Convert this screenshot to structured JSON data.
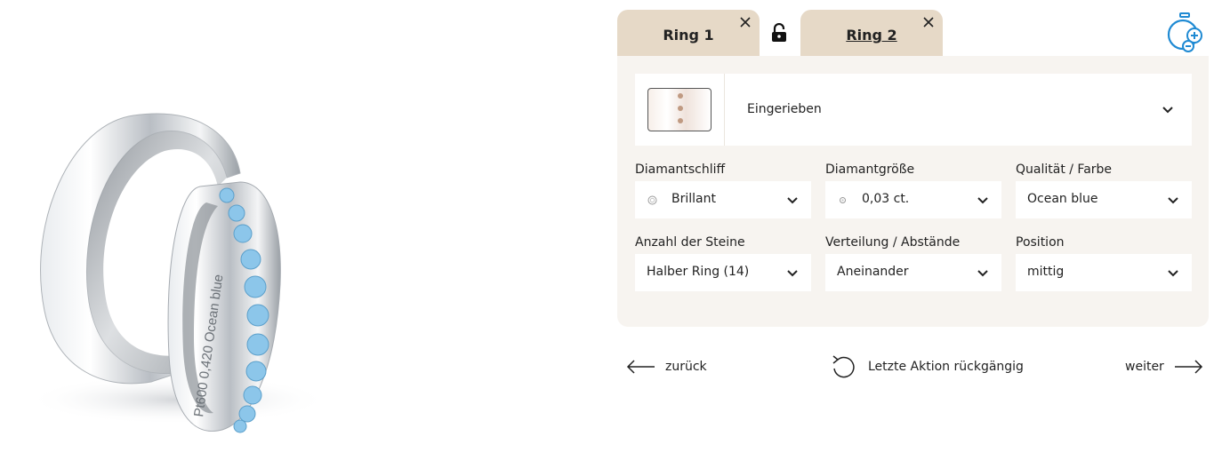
{
  "tabs": [
    {
      "label": "Ring 1"
    },
    {
      "label": "Ring 2"
    }
  ],
  "finish": {
    "selected": "Eingerieben"
  },
  "fields": {
    "diamond_cut": {
      "label": "Diamantschliff",
      "value": "Brillant"
    },
    "diamond_size": {
      "label": "Diamantgröße",
      "value": "0,03 ct."
    },
    "quality": {
      "label": "Qualität / Farbe",
      "value": "Ocean blue"
    },
    "stone_count": {
      "label": "Anzahl der Steine",
      "value": "Halber Ring (14)"
    },
    "distribution": {
      "label": "Verteilung / Abstände",
      "value": "Aneinander"
    },
    "position": {
      "label": "Position",
      "value": "mittig"
    }
  },
  "nav": {
    "back": "zurück",
    "undo": "Letzte Aktion rückgängig",
    "next": "weiter"
  },
  "ring_engraving": "Pt600 0,420 Ocean blue",
  "colors": {
    "tab_bg": "#e6d9c7",
    "panel_bg": "#f7f4f0",
    "accent_blue": "#1f8ad3",
    "stone_blue": "#8cc6ea"
  },
  "icons": [
    "close-icon",
    "lock-open-icon",
    "stopwatch-add-icon",
    "chevron-down-icon",
    "diamond-icon",
    "arrow-left-icon",
    "undo-icon",
    "arrow-right-icon"
  ]
}
